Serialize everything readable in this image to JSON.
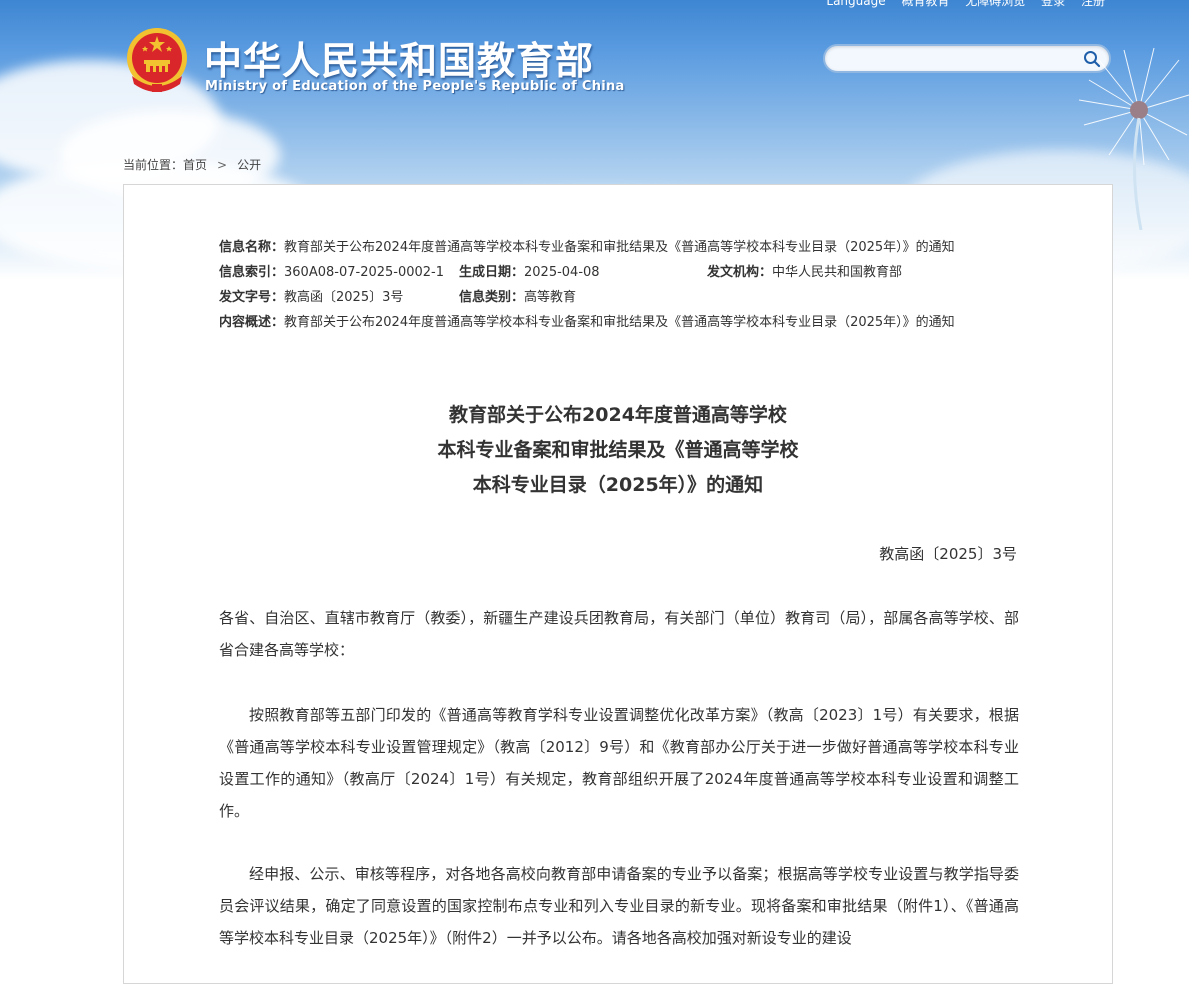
{
  "header": {
    "topbar_items": [
      "Language",
      "概育教育",
      "无障碍浏览",
      "登录",
      "注册"
    ],
    "site_title": "中华人民共和国教育部",
    "site_subtitle": "Ministry of Education of the People's Republic of China",
    "search_placeholder": ""
  },
  "breadcrumb": {
    "label": "当前位置：",
    "home": "首页",
    "separator": ">",
    "current": "公开"
  },
  "meta": {
    "name_key": "信息名称：",
    "name_val": "教育部关于公布2024年度普通高等学校本科专业备案和审批结果及《普通高等学校本科专业目录（2025年）》的通知",
    "index_key": "信息索引：",
    "index_val": "360A08-07-2025-0002-1",
    "date_key": "生成日期：",
    "date_val": "2025-04-08",
    "org_key": "发文机构：",
    "org_val": "中华人民共和国教育部",
    "docno_key": "发文字号：",
    "docno_val": "教高函〔2025〕3号",
    "type_key": "信息类别：",
    "type_val": "高等教育",
    "summary_key": "内容概述：",
    "summary_val": "教育部关于公布2024年度普通高等学校本科专业备案和审批结果及《普通高等学校本科专业目录（2025年）》的通知"
  },
  "document": {
    "title_lines": [
      "教育部关于公布2024年度普通高等学校",
      "本科专业备案和审批结果及《普通高等学校",
      "本科专业目录（2025年）》的通知"
    ],
    "doc_number": "教高函〔2025〕3号",
    "paragraphs": [
      "各省、自治区、直辖市教育厅（教委），新疆生产建设兵团教育局，有关部门（单位）教育司（局），部属各高等学校、部省合建各高等学校：",
      "按照教育部等五部门印发的《普通高等教育学科专业设置调整优化改革方案》（教高〔2023〕1号）有关要求，根据《普通高等学校本科专业设置管理规定》（教高〔2012〕9号）和《教育部办公厅关于进一步做好普通高等学校本科专业设置工作的通知》（教高厅〔2024〕1号）有关规定，教育部组织开展了2024年度普通高等学校本科专业设置和调整工作。",
      "经申报、公示、审核等程序，对各地各高校向教育部申请备案的专业予以备案；根据高等学校专业设置与教学指导委员会评议结果，确定了同意设置的国家控制布点专业和列入专业目录的新专业。现将备案和审批结果（附件1）、《普通高等学校本科专业目录（2025年）》（附件2）一并予以公布。请各地各高校加强对新设专业的建设"
    ]
  },
  "colors": {
    "sky_top": "#3e86d2",
    "emblem_red": "#d8262a",
    "emblem_gold": "#f2c230"
  }
}
